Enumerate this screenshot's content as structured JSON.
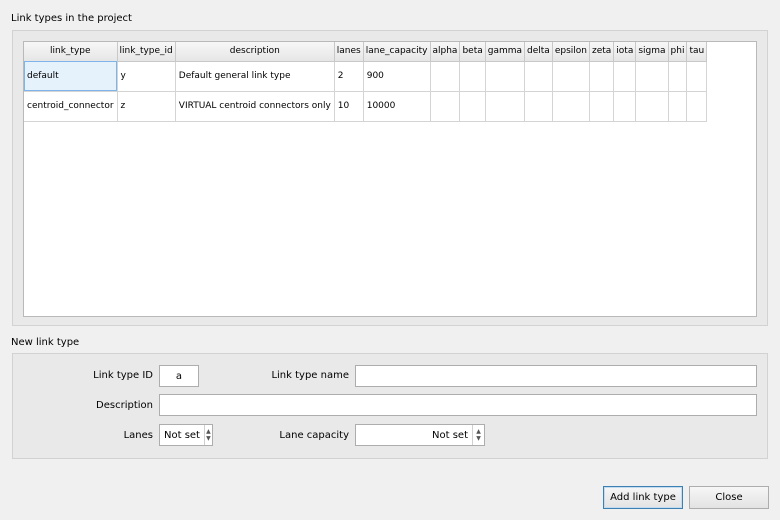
{
  "link_types_group": {
    "title": "Link types in the project"
  },
  "table": {
    "columns": [
      "link_type",
      "link_type_id",
      "description",
      "lanes",
      "lane_capacity",
      "alpha",
      "beta",
      "gamma",
      "delta",
      "epsilon",
      "zeta",
      "iota",
      "sigma",
      "phi",
      "tau"
    ],
    "rows": [
      [
        "default",
        "y",
        "Default general link type",
        "2",
        "900",
        "",
        "",
        "",
        "",
        "",
        "",
        "",
        "",
        "",
        ""
      ],
      [
        "centroid_connector",
        "z",
        "VIRTUAL centroid connectors only",
        "10",
        "10000",
        "",
        "",
        "",
        "",
        "",
        "",
        "",
        "",
        "",
        ""
      ]
    ]
  },
  "new_group": {
    "title": "New link type",
    "link_type_id_label": "Link type ID",
    "link_type_id_value": "a",
    "link_type_name_label": "Link type name",
    "link_type_name_value": "",
    "description_label": "Description",
    "description_value": "",
    "lanes_label": "Lanes",
    "lanes_value": "Not set",
    "lane_capacity_label": "Lane capacity",
    "lane_capacity_value": "Not set"
  },
  "buttons": {
    "add": "Add link type",
    "close": "Close"
  },
  "icons": {
    "spin_up": "spin-up-icon",
    "spin_down": "spin-down-icon"
  }
}
